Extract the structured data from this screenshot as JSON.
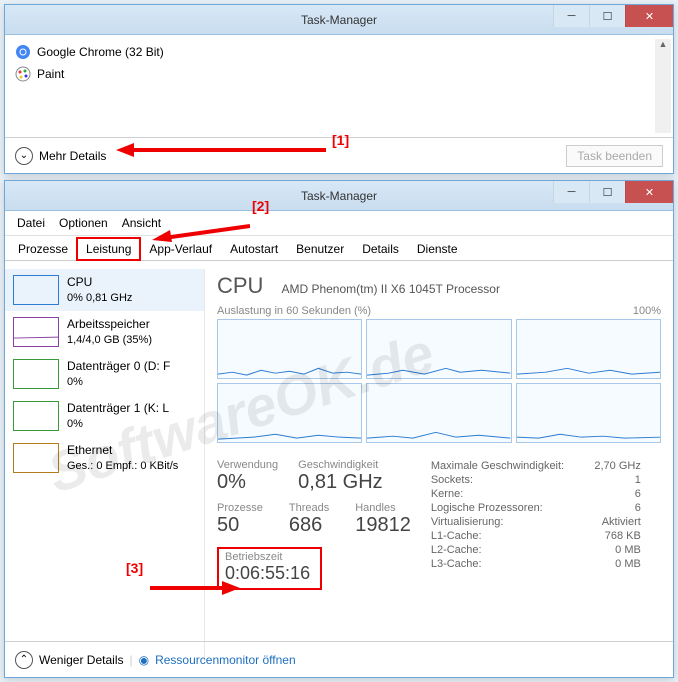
{
  "win1": {
    "title": "Task-Manager",
    "apps": [
      {
        "name": "Google Chrome (32 Bit)"
      },
      {
        "name": "Paint"
      }
    ],
    "moreDetails": "Mehr Details",
    "endTask": "Task beenden"
  },
  "win2": {
    "title": "Task-Manager",
    "menu": [
      "Datei",
      "Optionen",
      "Ansicht"
    ],
    "tabs": [
      "Prozesse",
      "Leistung",
      "App-Verlauf",
      "Autostart",
      "Benutzer",
      "Details",
      "Dienste"
    ],
    "activeTab": 1,
    "side": [
      {
        "title": "CPU",
        "sub": "0% 0,81 GHz",
        "cls": "cpu"
      },
      {
        "title": "Arbeitsspeicher",
        "sub": "1,4/4,0 GB (35%)",
        "cls": "mem"
      },
      {
        "title": "Datenträger 0 (D: F",
        "sub": "0%",
        "cls": "disk"
      },
      {
        "title": "Datenträger 1 (K: L",
        "sub": "0%",
        "cls": "disk"
      },
      {
        "title": "Ethernet",
        "sub": "Ges.: 0 Empf.: 0 KBit/s",
        "cls": "eth"
      }
    ],
    "cpu": {
      "heading": "CPU",
      "model": "AMD Phenom(tm) II X6 1045T Processor",
      "graphLabel": "Auslastung in 60 Sekunden (%)",
      "graphMax": "100%",
      "usage": {
        "lbl": "Verwendung",
        "val": "0%"
      },
      "speed": {
        "lbl": "Geschwindigkeit",
        "val": "0,81 GHz"
      },
      "proc": {
        "lbl": "Prozesse",
        "val": "50"
      },
      "threads": {
        "lbl": "Threads",
        "val": "686"
      },
      "handles": {
        "lbl": "Handles",
        "val": "19812"
      },
      "uptime": {
        "lbl": "Betriebszeit",
        "val": "0:06:55:16"
      },
      "details": [
        {
          "k": "Maximale Geschwindigkeit:",
          "v": "2,70 GHz"
        },
        {
          "k": "Sockets:",
          "v": "1"
        },
        {
          "k": "Kerne:",
          "v": "6"
        },
        {
          "k": "Logische Prozessoren:",
          "v": "6"
        },
        {
          "k": "Virtualisierung:",
          "v": "Aktiviert"
        },
        {
          "k": "L1-Cache:",
          "v": "768 KB"
        },
        {
          "k": "L2-Cache:",
          "v": "0 MB"
        },
        {
          "k": "L3-Cache:",
          "v": "0 MB"
        }
      ]
    },
    "lessDetails": "Weniger Details",
    "resmon": "Ressourcenmonitor öffnen"
  },
  "annotations": {
    "a1": "[1]",
    "a2": "[2]",
    "a3": "[3]"
  },
  "watermark": "SoftwareOK.de"
}
